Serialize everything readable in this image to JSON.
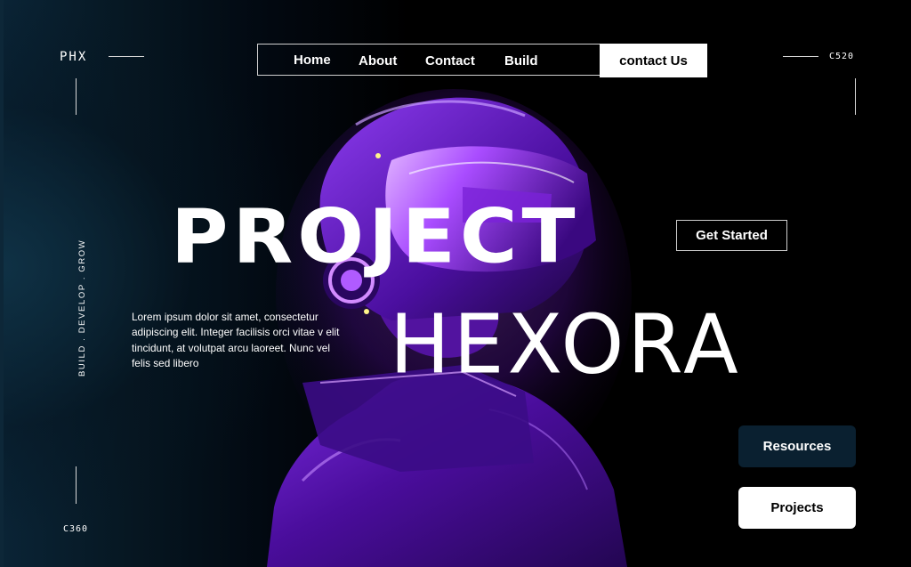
{
  "brand": {
    "logo": "PHX",
    "code_top_right": "C520",
    "code_bottom_left": "C360"
  },
  "nav": {
    "links": [
      "Home",
      "About",
      "Contact",
      "Build"
    ],
    "cta_label": "contact Us"
  },
  "hero": {
    "title_line1": "PROJECT",
    "title_line2": "HEXORA",
    "tagline_vertical": "BUILD . DEVELOP . GROW",
    "description": "Lorem ipsum dolor sit amet, consectetur adipiscing elit. Integer facilisis orci vitae v elit tincidunt, at volutpat arcu laoreet. Nunc vel felis sed libero",
    "get_started_label": "Get Started"
  },
  "actions": {
    "resources_label": "Resources",
    "projects_label": "Projects"
  },
  "image": {
    "subject": "purple-vr-headset-figure"
  },
  "colors": {
    "accent_purple": "#9b34ff",
    "dark_button": "#0a2030",
    "background": "#000000"
  }
}
